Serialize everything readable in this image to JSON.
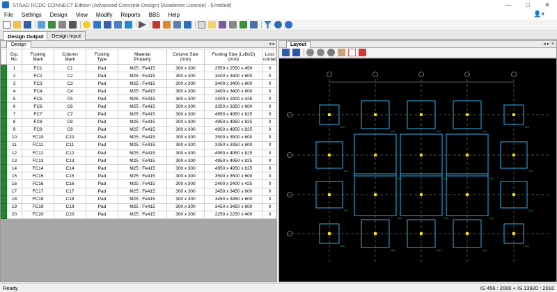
{
  "window": {
    "title": "STAAD RCDC CONNECT Edition (Advanced Concrete Design) [Academic License] - [Untitled]",
    "controls": {
      "minimize": "—",
      "maximize": "□",
      "close": "✕"
    }
  },
  "menu": [
    "File",
    "Settings",
    "Design",
    "View",
    "Modify",
    "Reports",
    "BBS",
    "Help"
  ],
  "tabs": {
    "design_output": "Design Output",
    "design_input": "Design Input"
  },
  "left_pane": {
    "subtab": "Design",
    "nav": "◂ ▸"
  },
  "right_pane": {
    "tab": "Layout",
    "nav": "◂ ▸ ✕"
  },
  "table": {
    "headers": [
      "Grp.\nNo.",
      "Footing\nMark",
      "Column\nMark",
      "Footing\nType",
      "Material\nProperty",
      "Column Size\n(mm)",
      "Footing Size (LxBxD)\n(mm)",
      "Loss\ncontac"
    ],
    "rows": [
      [
        "1",
        "FC1",
        "C1",
        "Pad",
        "M25 : Fe415",
        "300 x 300",
        "2550 x 2550 x 450",
        "0"
      ],
      [
        "2",
        "FC2",
        "C2",
        "Pad",
        "M25 : Fe415",
        "300 x 300",
        "3400 x 3400 x 600",
        "0"
      ],
      [
        "3",
        "FC3",
        "C3",
        "Pad",
        "M25 : Fe415",
        "300 x 300",
        "3400 x 3400 x 600",
        "0"
      ],
      [
        "4",
        "FC4",
        "C4",
        "Pad",
        "M25 : Fe415",
        "300 x 300",
        "3400 x 3400 x 600",
        "0"
      ],
      [
        "5",
        "FC5",
        "C5",
        "Pad",
        "M25 : Fe415",
        "300 x 300",
        "2400 x 2400 x 425",
        "0"
      ],
      [
        "6",
        "FC6",
        "C6",
        "Pad",
        "M25 : Fe415",
        "300 x 300",
        "3350 x 3350 x 600",
        "0"
      ],
      [
        "7",
        "FC7",
        "C7",
        "Pad",
        "M25 : Fe415",
        "300 x 300",
        "4950 x 4950 x 825",
        "0"
      ],
      [
        "8",
        "FC8",
        "C8",
        "Pad",
        "M25 : Fe415",
        "300 x 300",
        "4950 x 4950 x 825",
        "0"
      ],
      [
        "9",
        "FC9",
        "C9",
        "Pad",
        "M25 : Fe415",
        "300 x 300",
        "4950 x 4950 x 825",
        "0"
      ],
      [
        "10",
        "FC10",
        "C10",
        "Pad",
        "M25 : Fe415",
        "300 x 300",
        "3500 x 3500 x 600",
        "0"
      ],
      [
        "11",
        "FC11",
        "C11",
        "Pad",
        "M25 : Fe415",
        "300 x 300",
        "3350 x 3350 x 600",
        "0"
      ],
      [
        "12",
        "FC12",
        "C12",
        "Pad",
        "M25 : Fe415",
        "300 x 300",
        "4950 x 4950 x 825",
        "0"
      ],
      [
        "13",
        "FC13",
        "C13",
        "Pad",
        "M25 : Fe415",
        "300 x 300",
        "4950 x 4950 x 825",
        "0"
      ],
      [
        "14",
        "FC14",
        "C14",
        "Pad",
        "M25 : Fe415",
        "300 x 300",
        "4950 x 4950 x 825",
        "0"
      ],
      [
        "15",
        "FC15",
        "C15",
        "Pad",
        "M25 : Fe415",
        "300 x 300",
        "3500 x 3500 x 600",
        "0"
      ],
      [
        "16",
        "FC16",
        "C16",
        "Pad",
        "M25 : Fe415",
        "300 x 300",
        "2400 x 2400 x 425",
        "0"
      ],
      [
        "17",
        "FC17",
        "C17",
        "Pad",
        "M25 : Fe415",
        "300 x 300",
        "3450 x 3450 x 600",
        "0"
      ],
      [
        "18",
        "FC18",
        "C18",
        "Pad",
        "M25 : Fe415",
        "300 x 300",
        "3450 x 3450 x 600",
        "0"
      ],
      [
        "19",
        "FC19",
        "C19",
        "Pad",
        "M25 : Fe415",
        "300 x 300",
        "3450 x 3450 x 600",
        "0"
      ],
      [
        "20",
        "FC20",
        "C20",
        "Pad",
        "M25 : Fe415",
        "300 x 300",
        "2250 x 2250 x 400",
        "0"
      ]
    ]
  },
  "layout": {
    "colors": {
      "background": "#000000",
      "footing": "#27b4f2",
      "column": "#f4e300",
      "grid": "#ffffff",
      "label": "#2fc33f"
    }
  },
  "status": {
    "left": "Ready",
    "right": "IS 456 : 2000 + IS 13920 : 2016"
  }
}
